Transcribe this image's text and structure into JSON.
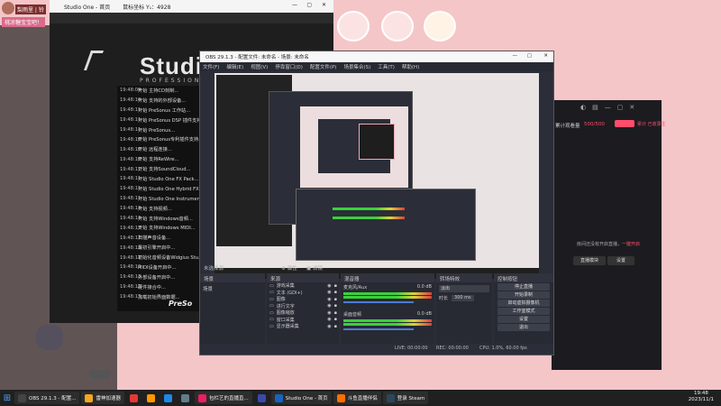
{
  "wallpaper": {
    "bg": "#f4c6c8"
  },
  "user_tag": {
    "name": "梨雨里 | 铃",
    "nickname": "桃凉糖宝宝吧！"
  },
  "studio_one": {
    "title": "Studio One - 首页",
    "coord_label": "鼠标坐标 Y₁：4928",
    "brand": "Studio",
    "brand_sub": "PROFESSIONAL",
    "brand_small": "PreSo",
    "log_rows": [
      {
        "time": "19:48:09",
        "text": "开始 主持CD刻制..."
      },
      {
        "time": "19:48:10",
        "text": "开始 支持的外部设备..."
      },
      {
        "time": "19:48:11",
        "text": "开始 PreSonus 工作站..."
      },
      {
        "time": "19:48:11",
        "text": "开始 PreSonus DSP 插件支持..."
      },
      {
        "time": "19:48:11",
        "text": "开始 PreSonus..."
      },
      {
        "time": "19:48:10",
        "text": "开始 PreSonus专利插件支持..."
      },
      {
        "time": "19:48:10",
        "text": "开始 远程连接..."
      },
      {
        "time": "19:48:10",
        "text": "开始 支持ReWire..."
      },
      {
        "time": "19:48:11",
        "text": "开始 支持SoundCloud..."
      },
      {
        "time": "19:48:11",
        "text": "开始 Studio One FX Pack..."
      },
      {
        "time": "19:48:11",
        "text": "开始 Studio One Hybrid FX Pack..."
      },
      {
        "time": "19:48:11",
        "text": "开始 Studio One Instruments..."
      },
      {
        "time": "19:48:13",
        "text": "开始 支持视频..."
      },
      {
        "time": "19:48:13",
        "text": "开始 支持Windows音频..."
      },
      {
        "time": "19:48:13",
        "text": "开始 支持Windows MIDI..."
      },
      {
        "time": "19:48:13",
        "text": "扫描声音设备..."
      },
      {
        "time": "19:48:13",
        "text": "最初引擎开启中..."
      },
      {
        "time": "19:48:13",
        "text": "初始化音频设备Widgius Stu..."
      },
      {
        "time": "19:48:13",
        "text": "MIDI设备开启中..."
      },
      {
        "time": "19:48:13",
        "text": "外部设备开启中..."
      },
      {
        "time": "19:48:13",
        "text": "硬件接合中..."
      },
      {
        "time": "19:48:13",
        "text": "加载初始界面数据..."
      }
    ]
  },
  "obs": {
    "title": "OBS 29.1.3 - 配置文件: 未命名 - 场景: 未命名",
    "menu": [
      "文件(F)",
      "编辑(E)",
      "视图(V)",
      "停靠窗口(D)",
      "配置文件(P)",
      "场景集合(S)",
      "工具(T)",
      "帮助(H)"
    ],
    "source_hint": "未选择源",
    "props_btn": "属性",
    "filters_btn": "滤镜",
    "docks": {
      "scenes": "场景",
      "sources": "来源",
      "mixer": "混音器",
      "transition": "转场特效",
      "controls": "控制按钮"
    },
    "scene_item": "场景",
    "sources": [
      "游戏采集",
      "文本 (GDI+)",
      "图像",
      "进行文字",
      "图像缩放",
      "窗口采集",
      "显示器采集"
    ],
    "mixer": [
      {
        "name": "麦克风/Aux",
        "db": "0.0 dB"
      },
      {
        "name": "桌面音频",
        "db": "0.0 dB"
      }
    ],
    "transition": {
      "type": "淡出",
      "duration_label": "时长",
      "duration": "300 ms"
    },
    "controls": [
      "停止直播",
      "开始录制",
      "启动虚拟摄像机",
      "工作室模式",
      "设置",
      "退出"
    ],
    "status": {
      "live": "LIVE: 00:00:00",
      "rec": "REC: 00:00:00",
      "cpu": "CPU: 1.0%, 60.00 fps"
    }
  },
  "right_app": {
    "counter_label": "累计观看量",
    "counter": "500/500",
    "counter_note": "累计 已收录主",
    "empty_text": "房间还没有开启直播",
    "link_text": "一键开启",
    "btn_left": "直播模块",
    "btn_right": "设置"
  },
  "taskbar": {
    "items": [
      {
        "label": "OBS 29.1.3 - 配置...",
        "color": "#444"
      },
      {
        "label": "雷神加速器",
        "color": "#f5a623"
      },
      {
        "label": "",
        "color": "#e53935"
      },
      {
        "label": "",
        "color": "#ff9800"
      },
      {
        "label": "",
        "color": "#1e88e5"
      },
      {
        "label": "",
        "color": "#607d8b"
      },
      {
        "label": "包栏艺的直播直...",
        "color": "#e91e63"
      },
      {
        "label": "",
        "color": "#3949ab"
      },
      {
        "label": "Studio One - 首页",
        "color": "#1565c0"
      },
      {
        "label": "斗鱼直播伴侣",
        "color": "#ff6f00"
      },
      {
        "label": "登录 Steam",
        "color": "#2a475e"
      }
    ],
    "time": "19:48",
    "date": "2023/11/1"
  }
}
